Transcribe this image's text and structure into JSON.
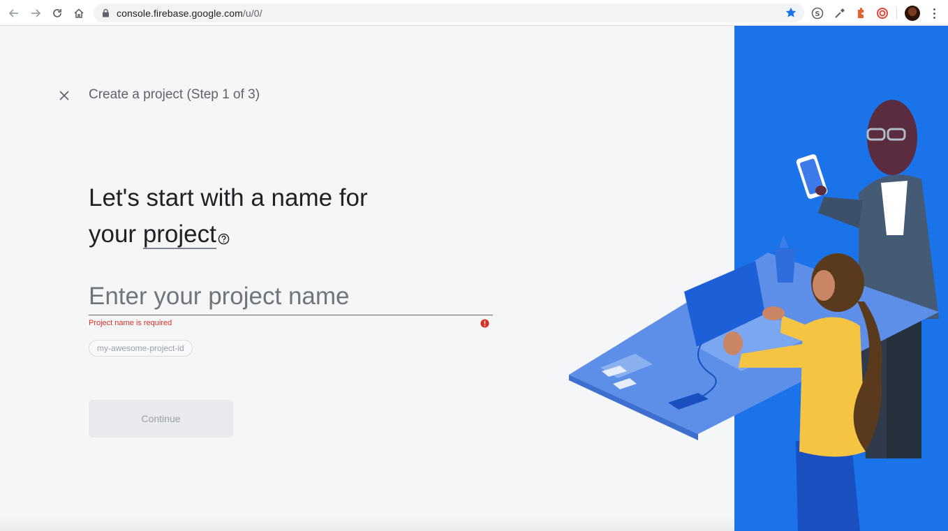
{
  "browser": {
    "url_host": "console.firebase.google.com",
    "url_path": "/u/0/",
    "icons": [
      "back-icon",
      "forward-icon",
      "reload-icon",
      "home-icon",
      "lock-icon",
      "bookmark-star-icon",
      "skype-extension-icon",
      "eyedropper-extension-icon",
      "puzzle-extension-icon",
      "pocket-extension-icon"
    ],
    "colors": {
      "star": "#1a73e8"
    }
  },
  "dialog": {
    "step_title": "Create a project (Step 1 of 3)",
    "heading_line1": "Let's start with a name for",
    "heading_line2_prefix": "your ",
    "heading_term": "project",
    "input_placeholder": "Enter your project name",
    "error_text": "Project name is required",
    "project_id_placeholder": "my-awesome-project-id",
    "continue_label": "Continue"
  },
  "colors": {
    "accent": "#1a73e8",
    "error": "#d93025",
    "background": "#f5f6f8"
  }
}
